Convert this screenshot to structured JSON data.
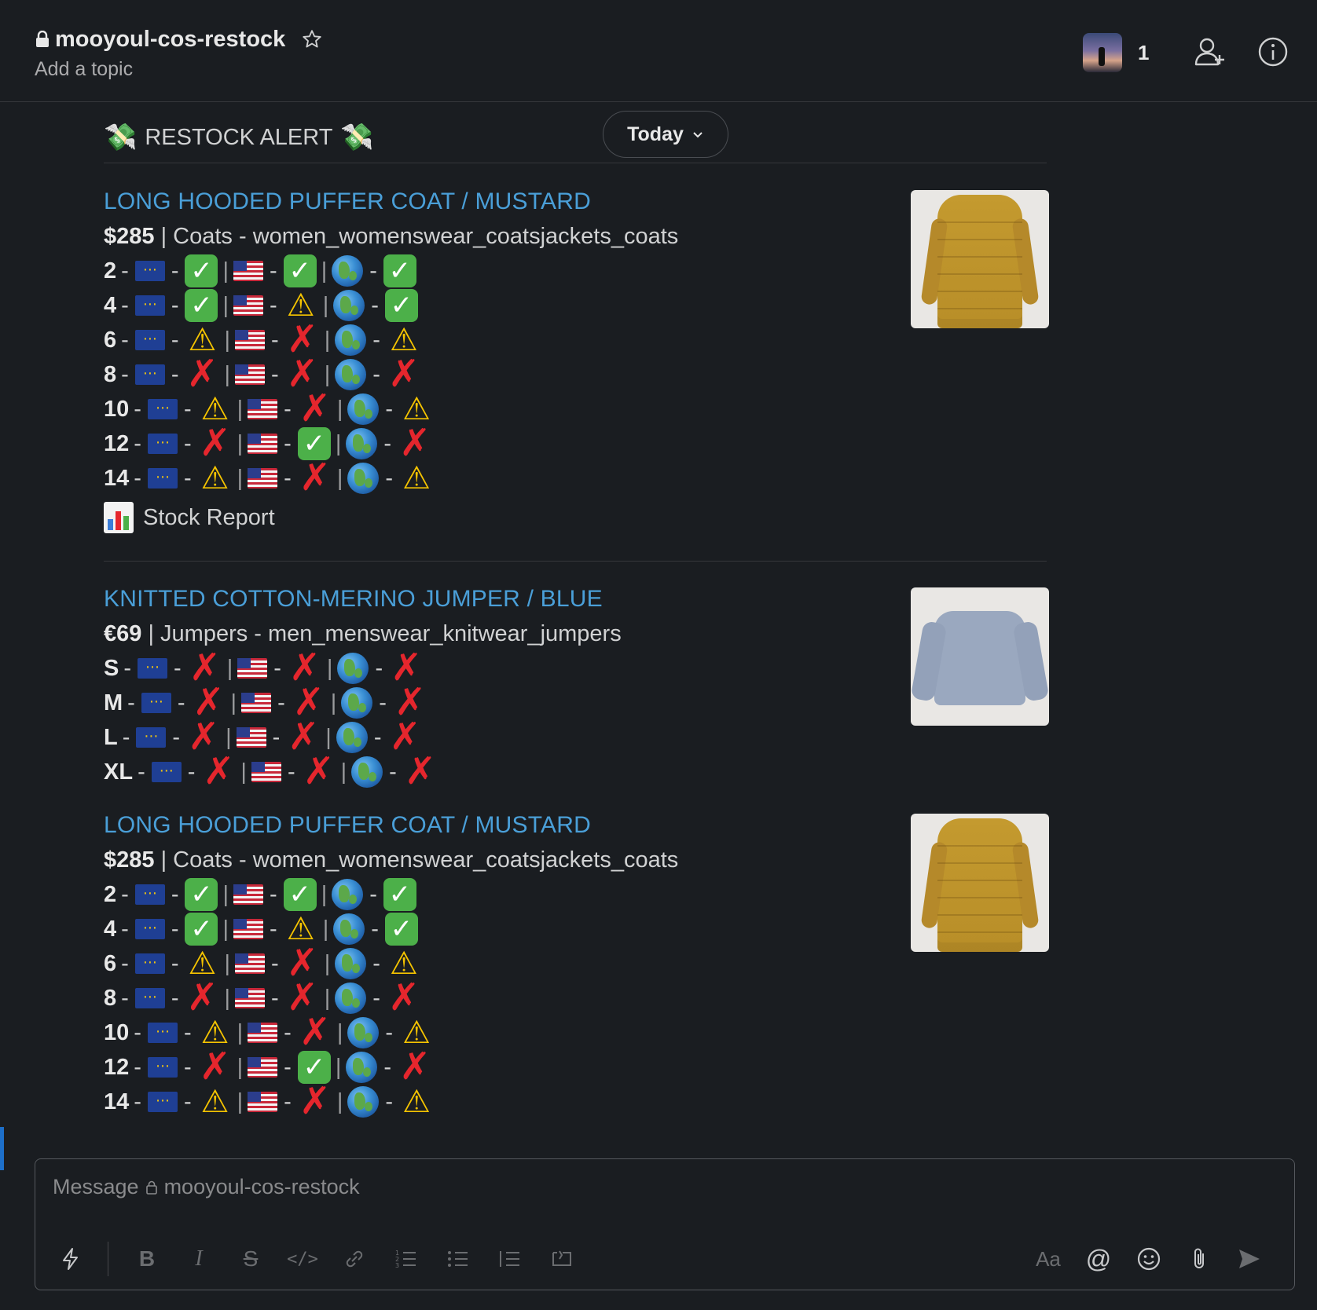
{
  "header": {
    "channel_name": "mooyoul-cos-restock",
    "topic": "Add a topic",
    "member_count": "1"
  },
  "alert": {
    "title": "RESTOCK ALERT",
    "date_pill": "Today"
  },
  "products": [
    {
      "title": "LONG HOODED PUFFER COAT / MUSTARD",
      "price": "$285",
      "category": " | Coats - women_womenswear_coatsjackets_coats",
      "image": "mustard-puffer-coat",
      "sizes": [
        {
          "size": "2",
          "eu": "ok",
          "us": "ok",
          "global": "ok"
        },
        {
          "size": "4",
          "eu": "ok",
          "us": "warn",
          "global": "ok"
        },
        {
          "size": "6",
          "eu": "warn",
          "us": "x",
          "global": "warn"
        },
        {
          "size": "8",
          "eu": "x",
          "us": "x",
          "global": "x"
        },
        {
          "size": "10",
          "eu": "warn",
          "us": "x",
          "global": "warn"
        },
        {
          "size": "12",
          "eu": "x",
          "us": "ok",
          "global": "x"
        },
        {
          "size": "14",
          "eu": "warn",
          "us": "x",
          "global": "warn"
        }
      ],
      "report_label": "Stock Report"
    },
    {
      "title": "KNITTED COTTON-MERINO JUMPER / BLUE",
      "price": "€69",
      "category": " | Jumpers - men_menswear_knitwear_jumpers",
      "image": "blue-jumper",
      "sizes": [
        {
          "size": "S",
          "eu": "x",
          "us": "x",
          "global": "x"
        },
        {
          "size": "M",
          "eu": "x",
          "us": "x",
          "global": "x"
        },
        {
          "size": "L",
          "eu": "x",
          "us": "x",
          "global": "x"
        },
        {
          "size": "XL",
          "eu": "x",
          "us": "x",
          "global": "x"
        }
      ]
    },
    {
      "title": "LONG HOODED PUFFER COAT / MUSTARD",
      "price": "$285",
      "category": " | Coats - women_womenswear_coatsjackets_coats",
      "image": "mustard-puffer-coat",
      "sizes": [
        {
          "size": "2",
          "eu": "ok",
          "us": "ok",
          "global": "ok"
        },
        {
          "size": "4",
          "eu": "ok",
          "us": "warn",
          "global": "ok"
        },
        {
          "size": "6",
          "eu": "warn",
          "us": "x",
          "global": "warn"
        },
        {
          "size": "8",
          "eu": "x",
          "us": "x",
          "global": "x"
        },
        {
          "size": "10",
          "eu": "warn",
          "us": "x",
          "global": "warn"
        },
        {
          "size": "12",
          "eu": "x",
          "us": "ok",
          "global": "x"
        },
        {
          "size": "14",
          "eu": "warn",
          "us": "x",
          "global": "warn"
        }
      ]
    }
  ],
  "composer": {
    "placeholder_prefix": "Message",
    "placeholder_channel": "mooyoul-cos-restock",
    "format_label": "Aa"
  },
  "colors": {
    "background": "#1a1d21",
    "link": "#4a9fd8",
    "ok": "#4cb049",
    "x": "#e5262d",
    "warn": "#f5c400"
  }
}
